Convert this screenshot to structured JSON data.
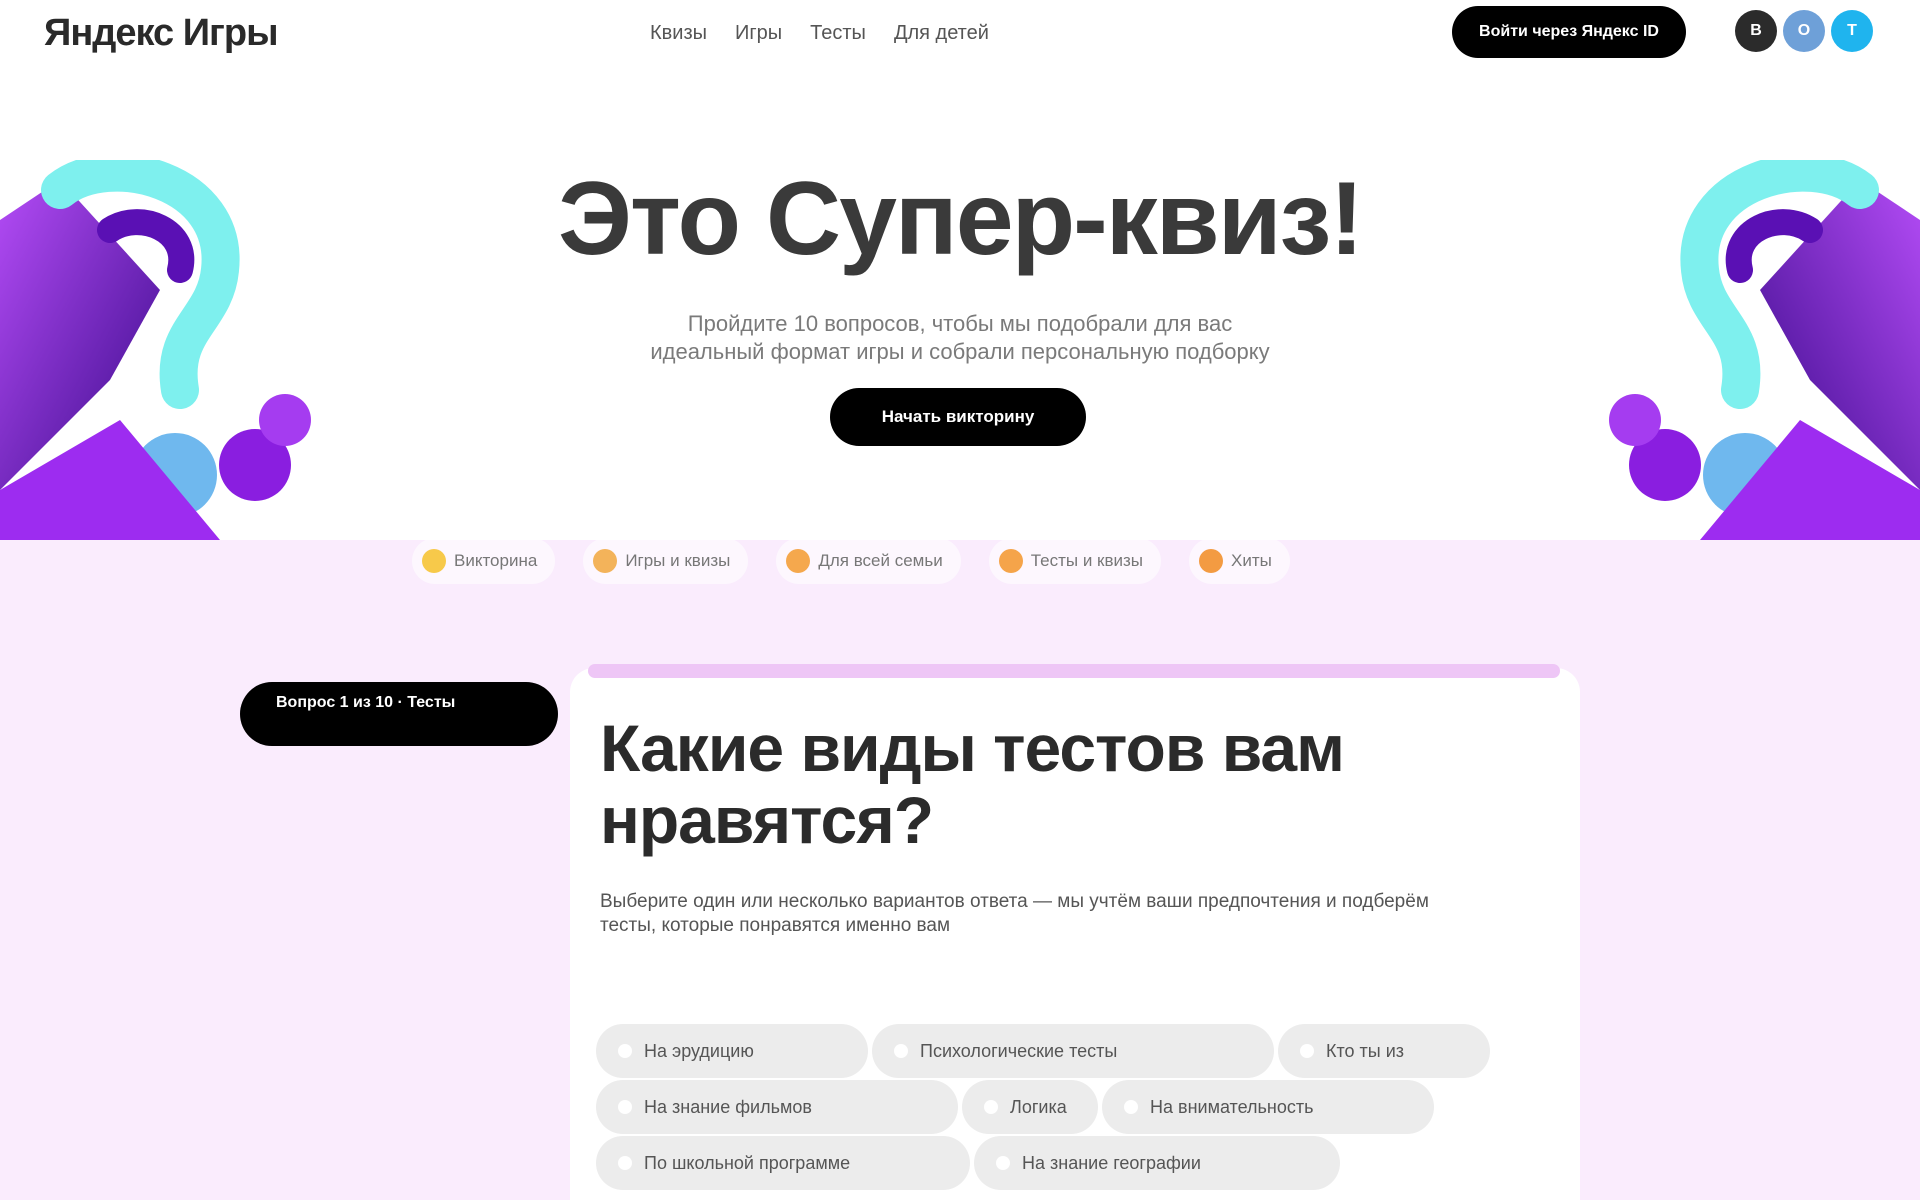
{
  "header": {
    "logo": "Яндекс Игры",
    "nav": [
      "Квизы",
      "Игры",
      "Тесты",
      "Для детей"
    ],
    "login_label": "Войти через Яндекс ID",
    "socials": [
      {
        "name": "vk",
        "glyph": "В",
        "color": "#2b2b2b"
      },
      {
        "name": "ok",
        "glyph": "О",
        "color": "#6ea0d8"
      },
      {
        "name": "telegram",
        "glyph": "T",
        "color": "#1fb4ee"
      }
    ]
  },
  "hero": {
    "title": "Это Супер-квиз!",
    "subtitle": "Пройдите 10 вопросов, чтобы мы подобрали для вас идеальный формат игры и собрали персональную подборку",
    "cta_label": "Начать викторину"
  },
  "tabs": [
    {
      "label": "Викторина",
      "dot_color": "#f7c94a"
    },
    {
      "label": "Игры и квизы",
      "dot_color": "#f3b35a"
    },
    {
      "label": "Для всей семьи",
      "dot_color": "#f5a84d"
    },
    {
      "label": "Тесты и квизы",
      "dot_color": "#f5a44a"
    },
    {
      "label": "Хиты",
      "dot_color": "#f39b42"
    }
  ],
  "question": {
    "badge": "Вопрос 1 из 10 · Тесты",
    "title": "Какие виды тестов вам нравятся?",
    "description": "Выберите один или несколько вариантов ответа — мы учтём ваши предпочтения и подберём тесты, которые понравятся именно вам",
    "options": [
      "На эрудицию",
      "Психологические тесты",
      "Кто ты из",
      "На знание фильмов",
      "Логика",
      "На внимательность",
      "По школьной программе",
      "На знание географии"
    ]
  },
  "colors": {
    "lavender_bg": "#faecfd",
    "accent_bar": "#eec6f6",
    "deco_purple": "#8a1ee0",
    "deco_cyan": "#7ef0ee"
  }
}
